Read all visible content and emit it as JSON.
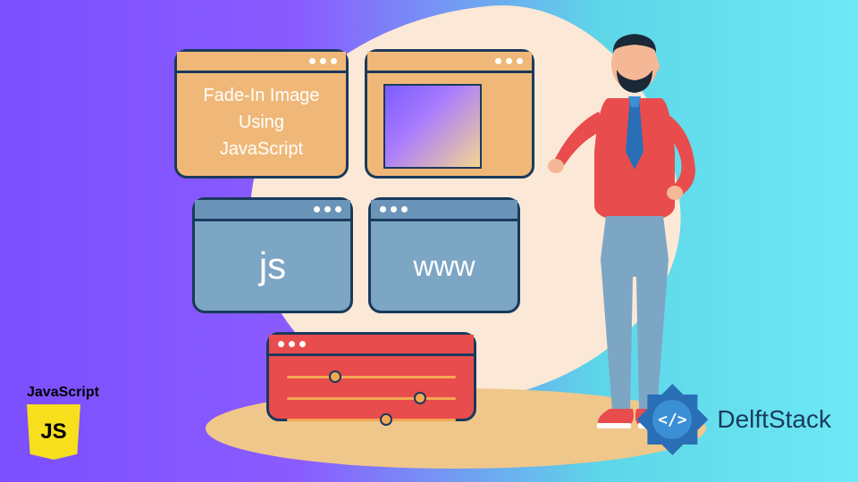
{
  "windows": {
    "title_card": {
      "line1": "Fade-In Image",
      "line2": "Using",
      "line3": "JavaScript"
    },
    "js": {
      "label": "js"
    },
    "www": {
      "label": "www"
    }
  },
  "sliders": {
    "positions": [
      0.25,
      0.75,
      0.55
    ]
  },
  "badges": {
    "js": {
      "title": "JavaScript",
      "logo_text": "JS"
    },
    "delft": {
      "text": "DelftStack",
      "inner": "</>"
    }
  },
  "colors": {
    "orange": "#f0b878",
    "blue": "#7da5c4",
    "red": "#e84c4c",
    "outline": "#1a3a5c",
    "js_yellow": "#f7df1e",
    "delft_blue": "#2a6fb5"
  }
}
